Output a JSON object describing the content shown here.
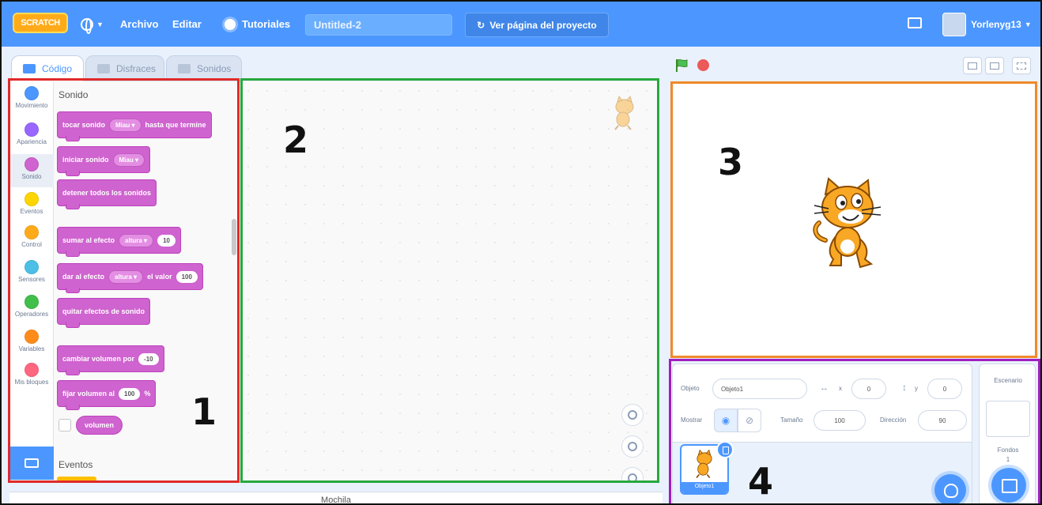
{
  "menubar": {
    "logo": "SCRATCH",
    "archivo": "Archivo",
    "editar": "Editar",
    "tutoriales": "Tutoriales",
    "project_title": "Untitled-2",
    "see_page": "Ver página del proyecto",
    "username": "Yorlenyg13",
    "icons": [
      "globe-icon",
      "lightbulb-icon",
      "folder-icon",
      "remix-icon"
    ]
  },
  "tabs": [
    {
      "label": "Código",
      "icon": "code-icon"
    },
    {
      "label": "Disfraces",
      "icon": "brush-icon"
    },
    {
      "label": "Sonidos",
      "icon": "speaker-icon"
    }
  ],
  "categories": [
    {
      "label": "Movimiento",
      "color": "#4c97ff"
    },
    {
      "label": "Apariencia",
      "color": "#9966ff"
    },
    {
      "label": "Sonido",
      "color": "#cf63cf"
    },
    {
      "label": "Eventos",
      "color": "#ffd500"
    },
    {
      "label": "Control",
      "color": "#ffab19"
    },
    {
      "label": "Sensores",
      "color": "#4cbfe6"
    },
    {
      "label": "Operadores",
      "color": "#40bf4a"
    },
    {
      "label": "Variables",
      "color": "#ff8c1a"
    },
    {
      "label": "Mis bloques",
      "color": "#ff6680"
    }
  ],
  "palette": {
    "sound_heading": "Sonido",
    "events_heading": "Eventos",
    "blocks": {
      "play_until_done": {
        "text": "tocar sonido",
        "dropdown": "Miau",
        "suffix": "hasta que termine"
      },
      "start_sound": {
        "text": "iniciar sonido",
        "dropdown": "Miau"
      },
      "stop_all": {
        "text": "detener todos los sonidos"
      },
      "change_effect": {
        "text": "sumar al efecto",
        "dropdown": "altura",
        "value": "10"
      },
      "set_effect": {
        "text": "dar al efecto",
        "dropdown": "altura",
        "middle": "el valor",
        "value": "100"
      },
      "clear_effects": {
        "text": "quitar efectos de sonido"
      },
      "change_volume": {
        "text": "cambiar volumen por",
        "value": "-10"
      },
      "set_volume": {
        "text": "fijar volumen al",
        "value": "100",
        "suffix": "%"
      },
      "volume_reporter": {
        "text": "volumen"
      }
    }
  },
  "backpack": "Mochila",
  "sprite_info": {
    "sprite_label": "Objeto",
    "sprite_name": "Objeto1",
    "x_label": "x",
    "x_value": "0",
    "y_label": "y",
    "y_value": "0",
    "show_label": "Mostrar",
    "size_label": "Tamaño",
    "size_value": "100",
    "direction_label": "Dirección",
    "direction_value": "90"
  },
  "sprite_list": [
    {
      "name": "Objeto1"
    }
  ],
  "stage_pane": {
    "title": "Escenario",
    "backdrops_label": "Fondos",
    "backdrop_count": "1"
  },
  "annotations": {
    "one": "1",
    "two": "2",
    "three": "3",
    "four": "4",
    "colors": {
      "one": "#e02a2a",
      "two": "#27a83d",
      "three": "#f08a2a",
      "four": "#a01fbe"
    }
  }
}
